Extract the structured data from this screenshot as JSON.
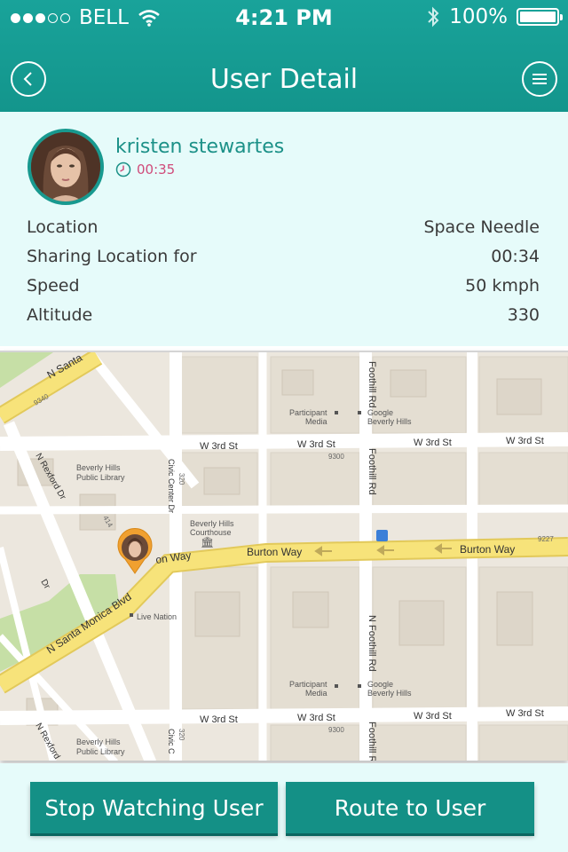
{
  "status_bar": {
    "carrier": "BELL",
    "time": "4:21 PM",
    "battery": "100%",
    "signal_icon": "signal-dots-icon",
    "wifi_icon": "wifi-icon",
    "bluetooth_icon": "bluetooth-icon",
    "battery_icon": "battery-icon"
  },
  "header": {
    "title": "User Detail",
    "back_icon": "chevron-left-icon",
    "menu_icon": "hamburger-menu-icon"
  },
  "user": {
    "name": "kristen stewartes",
    "elapsed": "00:35",
    "clock_icon": "clock-icon"
  },
  "details": [
    {
      "label": "Location",
      "value": "Space Needle"
    },
    {
      "label": "Sharing Location for",
      "value": "00:34"
    },
    {
      "label": "Speed",
      "value": "50 kmph"
    },
    {
      "label": "Altitude",
      "value": "330"
    }
  ],
  "map": {
    "labels": {
      "n_santa_top": "N Santa",
      "n9340": "9340",
      "foothill_rd_top": "Foothill Rd",
      "participant_media_1": "Participant",
      "participant_media_2": "Media",
      "google_1": "Google",
      "google_2": "Beverly Hills",
      "w3rd_1": "W 3rd St",
      "w3rd_2": "W 3rd St",
      "w3rd_3": "W 3rd St",
      "w3rd_4": "W 3rd St",
      "n9300": "9300",
      "foothill_rd_mid": "Foothill Rd",
      "n_rexford": "N Rexford Dr",
      "library_1": "Beverly Hills",
      "library_2": "Public Library",
      "civic_center": "Civic Center Dr",
      "n320": "320",
      "courthouse_1": "Beverly Hills",
      "courthouse_2": "Courthouse",
      "n414": "414",
      "burton_way_1": "Burton Way",
      "burton_way_2": "Burton Way",
      "burton_way_3": "on Way",
      "n9227": "9227",
      "dr": "Dr",
      "n_santa_monica": "N Santa Monica Blvd",
      "live_nation": "Live Nation",
      "n_foothill_bottom": "N Foothill Rd",
      "participant_media_3": "Participant",
      "participant_media_4": "Media",
      "google_3": "Google",
      "google_4": "Beverly Hills",
      "w3rd_5": "W 3rd St",
      "w3rd_6": "W 3rd St",
      "w3rd_7": "W 3rd St",
      "w3rd_8": "W 3rd St",
      "n9300b": "9300",
      "n_rexford_b": "N Rexford",
      "library_3": "Beverly Hills",
      "library_4": "Public Library",
      "civic_center_b": "Civic C",
      "n320b": "320",
      "foothill_bottom": "Foothill R"
    },
    "pin_color": "#f0a030",
    "road_color": "#f7e37a"
  },
  "actions": {
    "stop_label": "Stop Watching User",
    "route_label": "Route to User"
  },
  "colors": {
    "accent": "#149086",
    "panel": "#e6fbfa",
    "name": "#1c9188",
    "time": "#d04b7a"
  }
}
